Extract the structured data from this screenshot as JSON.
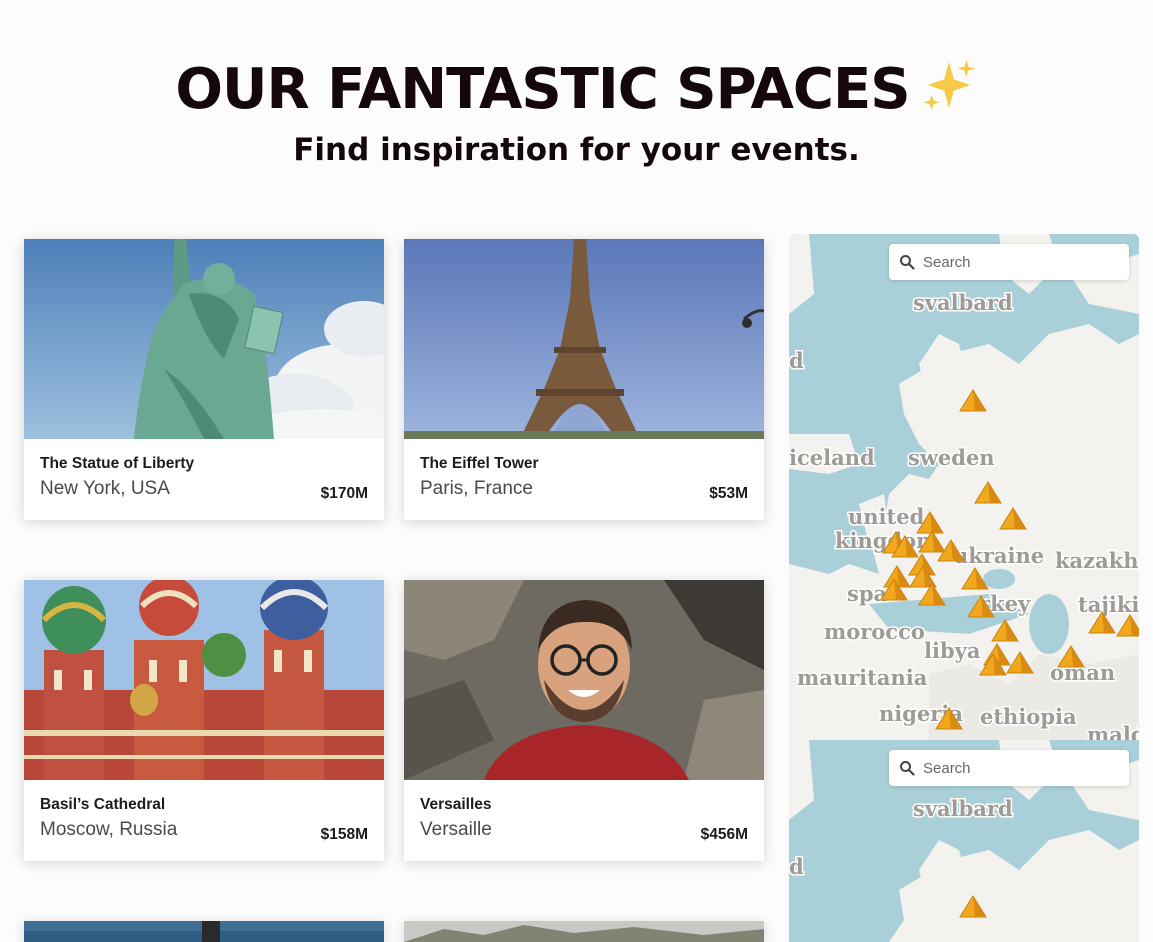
{
  "hero": {
    "title": "OUR FANTASTIC SPACES",
    "subtitle": "Find inspiration for your events."
  },
  "cards": [
    {
      "name": "The Statue of Liberty",
      "location": "New York, USA",
      "price": "$170M",
      "image": "statue-of-liberty-photo"
    },
    {
      "name": "The Eiffel Tower",
      "location": "Paris, France",
      "price": "$53M",
      "image": "eiffel-tower-photo"
    },
    {
      "name": "Basil’s Cathedral",
      "location": "Moscow, Russia",
      "price": "$158M",
      "image": "basils-cathedral-photo"
    },
    {
      "name": "Versailles",
      "location": "Versaille",
      "price": "$456M",
      "image": "smiling-man-portrait-photo"
    }
  ],
  "map": {
    "search_placeholder": "Search",
    "labels": [
      "svalbard",
      "d",
      "iceland",
      "sweden",
      "united",
      "kingdom",
      "ukraine",
      "kazakhst",
      "spa",
      "rkey",
      "tajikis",
      "morocco",
      "libya",
      "mauritania",
      "oman",
      "nigeria",
      "ethiopia",
      "mald"
    ],
    "labels_lower": [
      "svalbard",
      "d"
    ],
    "marker_icon": "pyramid-marker-icon",
    "colors": {
      "water": "#a9d0d8",
      "land": "#f4f2ee",
      "marker": "#f2a81d"
    }
  }
}
